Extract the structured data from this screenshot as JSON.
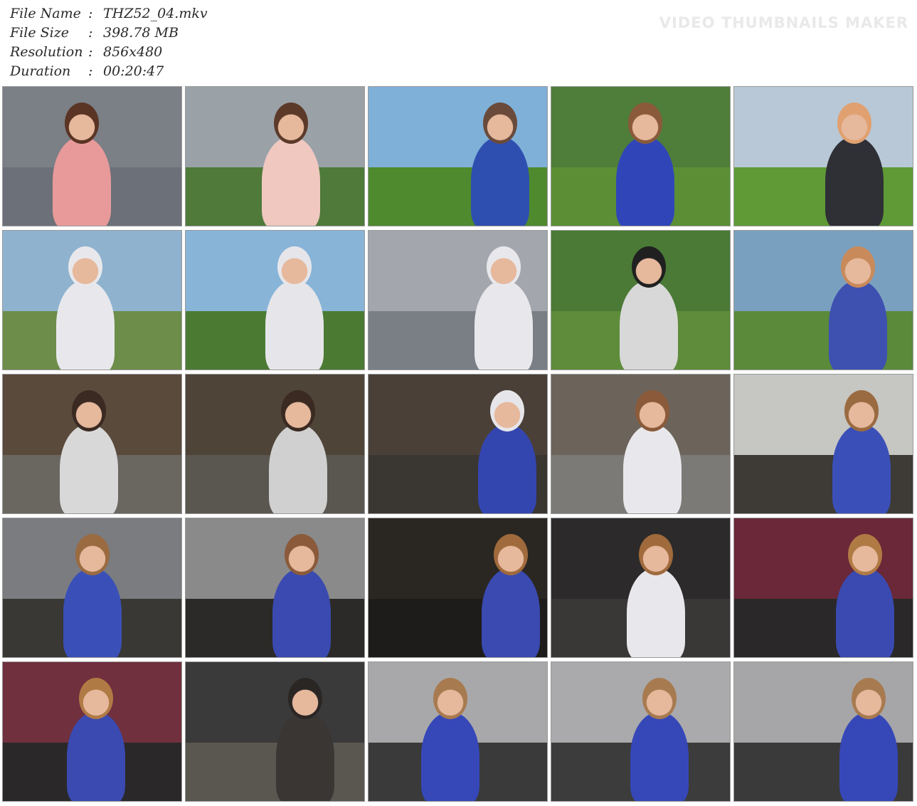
{
  "file_info": [
    {
      "label": "File Name",
      "sep": ":",
      "value": "THZ52_04.mkv"
    },
    {
      "label": "File Size",
      "sep": ":",
      "value": "398.78 MB"
    },
    {
      "label": "Resolution",
      "sep": ":",
      "value": "856x480"
    },
    {
      "label": "Duration",
      "sep": ":",
      "value": "00:20:47"
    }
  ],
  "watermark": {
    "title": "VIDEO THUMBNAILS MAKER",
    "subtitle": ""
  },
  "thumbnails": [
    {
      "bg": "#7b7f86",
      "ground": "#6c7078",
      "figure": "#e89a9a",
      "hair": "#5a3424"
    },
    {
      "bg": "#9aa2a8",
      "ground": "#4f7a3a",
      "figure": "#f0c8c0",
      "hair": "#5c3a2a"
    },
    {
      "bg": "#7fb0d8",
      "ground": "#4f8a2e",
      "figure": "#2f4fb0",
      "hair": "#6a4a3a"
    },
    {
      "bg": "#4f7d3a",
      "ground": "#5c8f35",
      "figure": "#3046b8",
      "hair": "#8a5a3a"
    },
    {
      "bg": "#b8c8d6",
      "ground": "#5f9a36",
      "figure": "#2f2f36",
      "hair": "#e0a070"
    },
    {
      "bg": "#8fb2cf",
      "ground": "#6d8d4a",
      "figure": "#e8e8ec",
      "hair": "#e8e8ec"
    },
    {
      "bg": "#88b4d8",
      "ground": "#4b7a33",
      "figure": "#e6e6ea",
      "hair": "#e6e6ea"
    },
    {
      "bg": "#a3a7ad",
      "ground": "#7a7f86",
      "figure": "#e8e8ec",
      "hair": "#e8e8ec"
    },
    {
      "bg": "#4a7a36",
      "ground": "#5e8c3a",
      "figure": "#d8d8d8",
      "hair": "#202020"
    },
    {
      "bg": "#7aa0bf",
      "ground": "#5a8a3a",
      "figure": "#3e50b0",
      "hair": "#c88a5a"
    },
    {
      "bg": "#5a4a3c",
      "ground": "#6a6660",
      "figure": "#d8d8d8",
      "hair": "#3a2a22"
    },
    {
      "bg": "#4e4438",
      "ground": "#5a5650",
      "figure": "#d0d0d0",
      "hair": "#3a2a22"
    },
    {
      "bg": "#4a4038",
      "ground": "#3a3632",
      "figure": "#3346b0",
      "hair": "#e6e6ea"
    },
    {
      "bg": "#6c645a",
      "ground": "#7c7a76",
      "figure": "#e8e8ec",
      "hair": "#8a5a3a"
    },
    {
      "bg": "#c6c6c2",
      "ground": "#3e3a36",
      "figure": "#3a50b8",
      "hair": "#9a6a40"
    },
    {
      "bg": "#7a7c80",
      "ground": "#3a3834",
      "figure": "#3a50b8",
      "hair": "#9a6a40"
    },
    {
      "bg": "#8a8a8a",
      "ground": "#2c2a28",
      "figure": "#3a4ab0",
      "hair": "#8a5a3a"
    },
    {
      "bg": "#2a2622",
      "ground": "#1e1c1a",
      "figure": "#3a4ab0",
      "hair": "#a06a3c"
    },
    {
      "bg": "#2c2a2a",
      "ground": "#3a3836",
      "figure": "#e8e8ec",
      "hair": "#a06a3c"
    },
    {
      "bg": "#6a2838",
      "ground": "#2a2828",
      "figure": "#3a4ab0",
      "hair": "#b07a44"
    },
    {
      "bg": "#70303e",
      "ground": "#2a2828",
      "figure": "#3a4ab0",
      "hair": "#b07a44"
    },
    {
      "bg": "#3a3a3a",
      "ground": "#5a5650",
      "figure": "#3a3634",
      "hair": "#2a2624"
    },
    {
      "bg": "#a8a8aa",
      "ground": "#3a3a3a",
      "figure": "#3648b8",
      "hair": "#a87a50"
    },
    {
      "bg": "#aaaaac",
      "ground": "#3c3c3c",
      "figure": "#3648b8",
      "hair": "#a87a50"
    },
    {
      "bg": "#a6a6a8",
      "ground": "#3a3a3a",
      "figure": "#3648b8",
      "hair": "#a87a50"
    }
  ]
}
